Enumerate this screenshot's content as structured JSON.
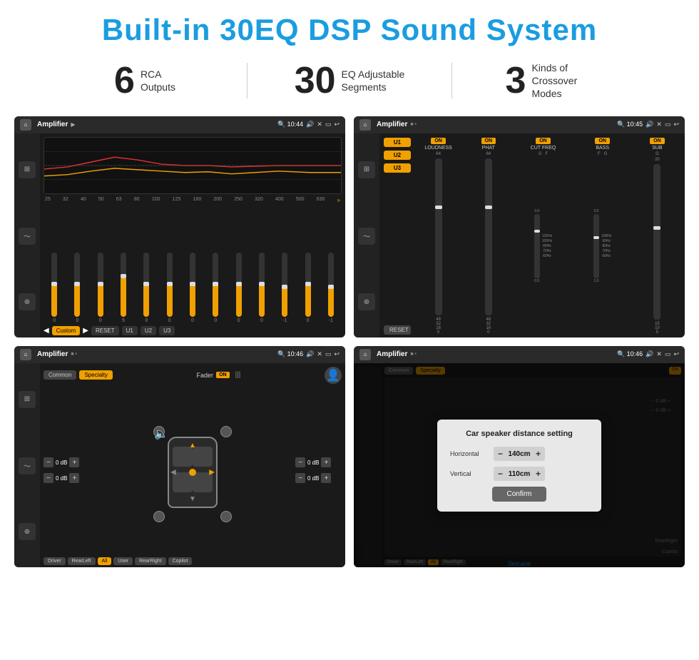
{
  "header": {
    "title": "Built-in 30EQ DSP Sound System"
  },
  "stats": [
    {
      "number": "6",
      "text": "RCA\nOutputs"
    },
    {
      "number": "30",
      "text": "EQ Adjustable\nSegments"
    },
    {
      "number": "3",
      "text": "Kinds of\nCrossover Modes"
    }
  ],
  "screens": [
    {
      "id": "eq-screen",
      "title": "Amplifier",
      "time": "10:44",
      "type": "eq"
    },
    {
      "id": "amp-screen",
      "title": "Amplifier",
      "time": "10:45",
      "type": "amp"
    },
    {
      "id": "speaker-screen",
      "title": "Amplifier",
      "time": "10:46",
      "type": "speaker"
    },
    {
      "id": "dialog-screen",
      "title": "Amplifier",
      "time": "10:46",
      "type": "dialog"
    }
  ],
  "eq": {
    "freq_labels": [
      "25",
      "32",
      "40",
      "50",
      "63",
      "80",
      "100",
      "125",
      "160",
      "200",
      "250",
      "320",
      "400",
      "500",
      "630"
    ],
    "values": [
      "0",
      "0",
      "0",
      "5",
      "0",
      "0",
      "0",
      "0",
      "0",
      "0",
      "-1",
      "0",
      "-1"
    ],
    "nav_buttons": [
      "Custom",
      "RESET",
      "U1",
      "U2",
      "U3"
    ]
  },
  "amp": {
    "presets": [
      "U1",
      "U2",
      "U3"
    ],
    "toggles": [
      "ON",
      "ON",
      "ON",
      "ON",
      "ON"
    ],
    "labels": [
      "LOUDNESS",
      "PHAT",
      "CUT FREQ",
      "BASS",
      "SUB"
    ],
    "sublabels": [
      "",
      "",
      "G  F",
      "F  G",
      "G"
    ],
    "reset": "RESET"
  },
  "speaker": {
    "tabs": [
      "Common",
      "Specialty"
    ],
    "fader": "Fader",
    "db_values": [
      "0 dB",
      "0 dB",
      "0 dB",
      "0 dB"
    ],
    "buttons": [
      "Driver",
      "RearLeft",
      "All",
      "User",
      "RearRight",
      "Copilot"
    ]
  },
  "dialog": {
    "title": "Car speaker distance setting",
    "horizontal_label": "Horizontal",
    "horizontal_value": "140cm",
    "vertical_label": "Vertical",
    "vertical_value": "110cm",
    "confirm_label": "Confirm"
  },
  "watermark": "Seicane"
}
